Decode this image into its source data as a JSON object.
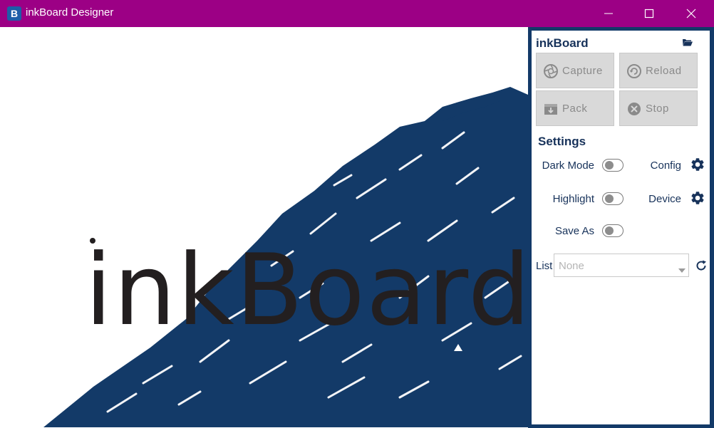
{
  "window": {
    "title": "inkBoard Designer",
    "app_icon": "inkboard-app-icon",
    "app_icon_letter": "B",
    "controls": [
      "minimize-icon",
      "maximize-icon",
      "close-icon"
    ],
    "titlebar_color": "#9c0085"
  },
  "canvas": {
    "logo_text": "inkBoard",
    "brush_color": "#133a68",
    "text_color": "#231f20"
  },
  "panel": {
    "title": "inkBoard",
    "folder_icon": "folder-open-icon",
    "buttons": [
      {
        "label": "Capture",
        "icon": "camera-shutter-icon"
      },
      {
        "label": "Reload",
        "icon": "reload-icon"
      },
      {
        "label": "Pack",
        "icon": "package-icon"
      },
      {
        "label": "Stop",
        "icon": "stop-circle-icon"
      }
    ],
    "settings": {
      "title": "Settings",
      "toggles": [
        {
          "label": "Dark Mode",
          "on": false
        },
        {
          "label": "Highlight",
          "on": false
        },
        {
          "label": "Save As",
          "on": false
        }
      ],
      "gear_items": [
        {
          "label": "Config",
          "icon": "gear-icon"
        },
        {
          "label": "Device",
          "icon": "gear-icon"
        }
      ]
    },
    "list": {
      "label": "List",
      "selected": "None",
      "refresh_icon": "refresh-icon"
    }
  }
}
